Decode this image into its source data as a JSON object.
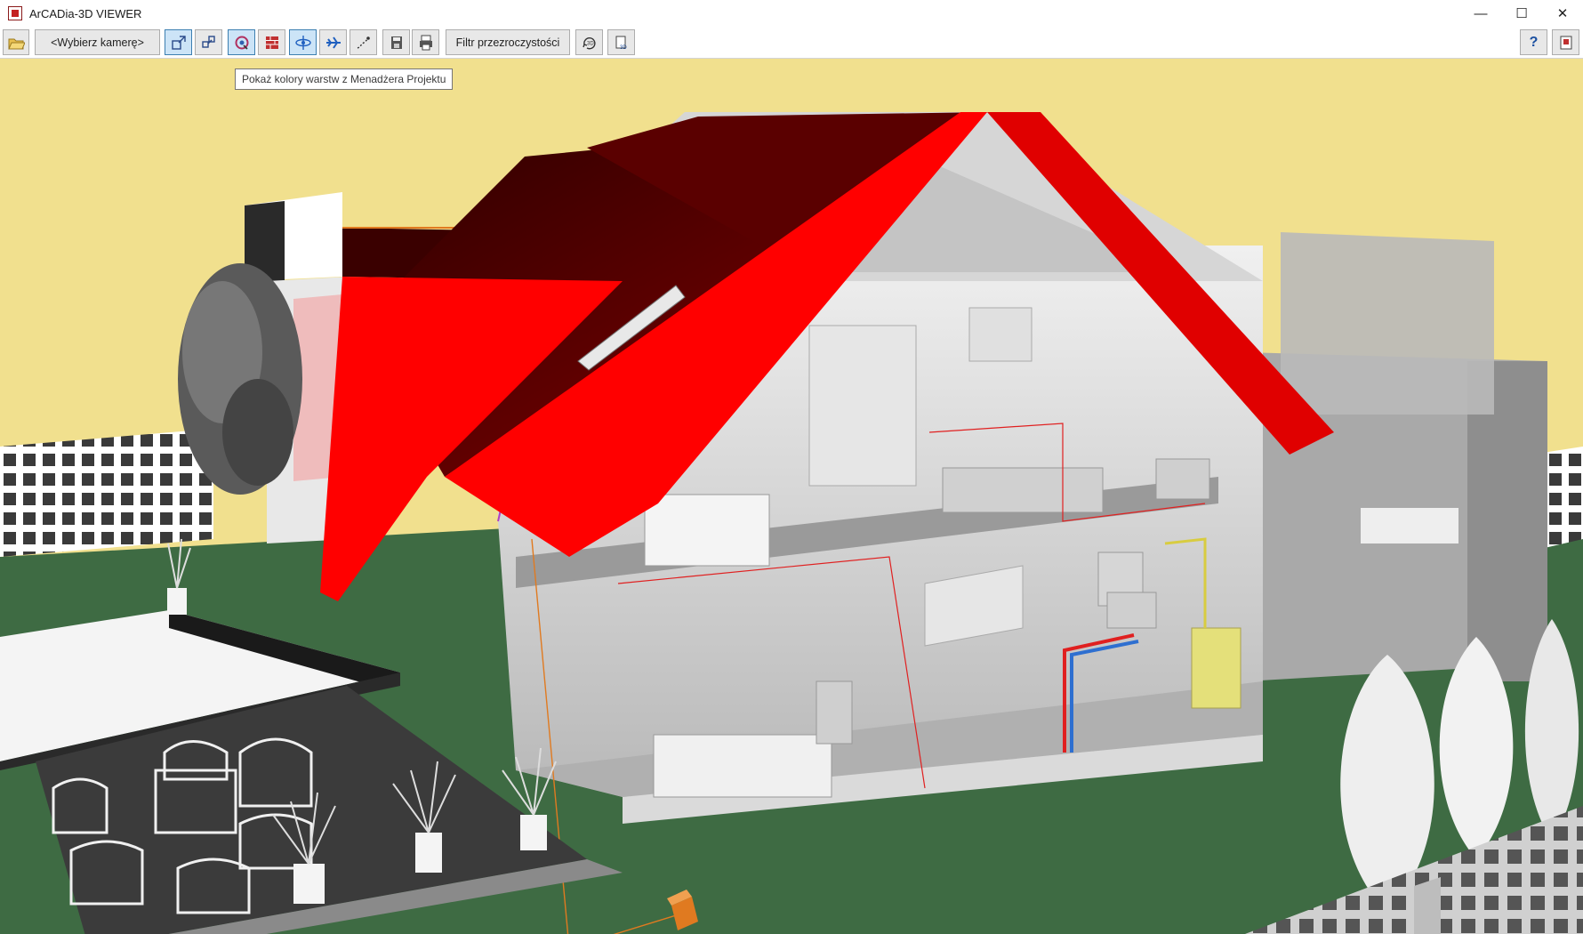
{
  "window": {
    "title": "ArCADia-3D VIEWER",
    "controls": {
      "minimize": "—",
      "maximize": "☐",
      "close": "✕"
    }
  },
  "toolbar": {
    "camera_select": "<Wybierz kamerę>",
    "transparency_filter": "Filtr przezroczystości",
    "help": "?",
    "buttons": [
      {
        "name": "open-file-icon"
      },
      {
        "name": "camera-select-button"
      },
      {
        "name": "view-mode-1-icon",
        "active": true
      },
      {
        "name": "view-mode-2-icon"
      },
      {
        "name": "layer-colors-icon",
        "active": true
      },
      {
        "name": "brick-wall-icon"
      },
      {
        "name": "orbit-icon",
        "active": true
      },
      {
        "name": "fly-mode-icon"
      },
      {
        "name": "walk-path-icon"
      },
      {
        "name": "save-view-icon"
      },
      {
        "name": "print-icon"
      },
      {
        "name": "transparency-filter-button"
      },
      {
        "name": "3d-rotate-icon"
      },
      {
        "name": "3d-export-icon"
      },
      {
        "name": "help-icon"
      },
      {
        "name": "exit-icon"
      }
    ]
  },
  "tooltip": {
    "text": "Pokaż kolory warstw z Menadżera Projektu"
  },
  "colors": {
    "sky": "#f1e08e",
    "grass": "#3e6b43",
    "roof_red": "#ff0000",
    "roof_dark": "#4a0000",
    "walls": "#d8d8d8",
    "pipe_blue": "#2e6fd0",
    "pipe_red": "#e02020",
    "boiler_yellow": "#e4e07a",
    "accent_orange": "#e07a20"
  }
}
